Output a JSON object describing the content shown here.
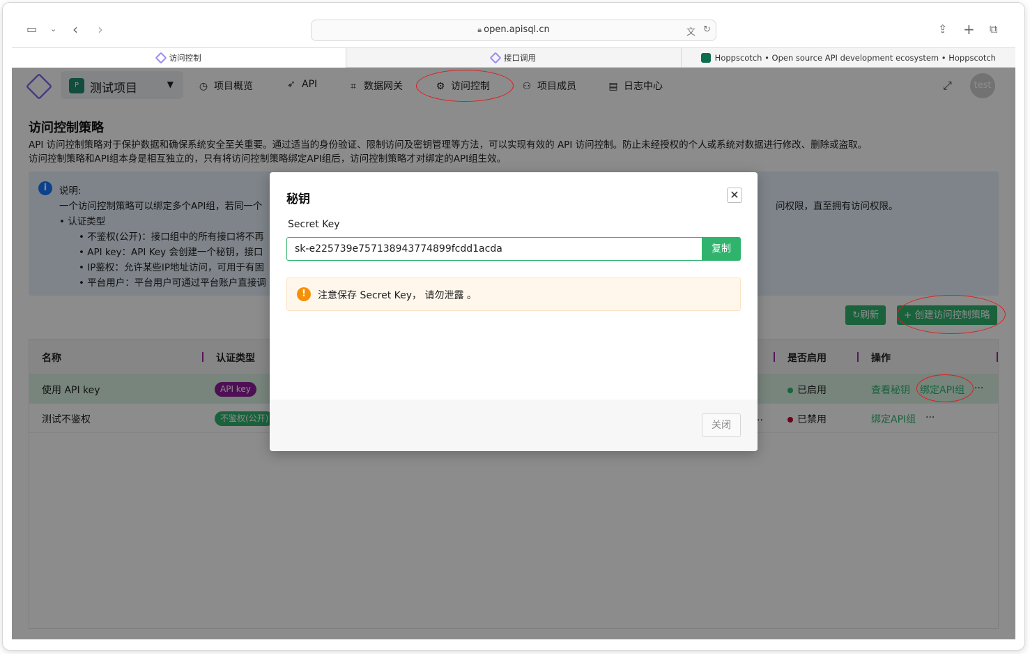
{
  "browser": {
    "url": "open.apisql.cn",
    "tabs": [
      {
        "label": "访问控制",
        "active": true
      },
      {
        "label": "接口调用",
        "active": false
      },
      {
        "label": "Hoppscotch • Open source API development ecosystem • Hoppscotch",
        "active": false
      }
    ]
  },
  "nav": {
    "project": "测试项目",
    "project_icon_letter": "P",
    "items": [
      {
        "label": "项目概览",
        "icon": "dashboard-icon"
      },
      {
        "label": "API",
        "icon": "rocket-icon"
      },
      {
        "label": "数据网关",
        "icon": "gateway-icon"
      },
      {
        "label": "访问控制",
        "icon": "gear-icon"
      },
      {
        "label": "项目成员",
        "icon": "members-icon"
      },
      {
        "label": "日志中心",
        "icon": "log-icon"
      }
    ],
    "avatar": "test"
  },
  "page": {
    "title": "访问控制策略",
    "desc1": "API 访问控制策略对于保护数据和确保系统安全至关重要。通过适当的身份验证、限制访问及密钥管理等方法，可以实现有效的 API 访问控制。防止未经授权的个人或系统对数据进行修改、删除或盗取。",
    "desc2": "访问控制策略和API组本身是相互独立的，只有将访问控制策略绑定API组后，访问控制策略才对绑定的API组生效。"
  },
  "info": {
    "heading": "说明:",
    "line1_left": "一个访问控制策略可以绑定多个API组，若同一个",
    "line1_right": "问权限，直至拥有访问权限。",
    "bullet_auth": "认证类型",
    "sub1": "不鉴权(公开)：接口组中的所有接口将不再",
    "sub2": "API key：API Key 会创建一个秘钥，接口",
    "sub3": "IP鉴权：允许某些IP地址访问，可用于有固",
    "sub4": "平台用户：平台用户可通过平台账户直接调"
  },
  "actions": {
    "refresh": "刷新",
    "create": "创建访问控制策略"
  },
  "table": {
    "headers": {
      "name": "名称",
      "auth": "认证类型",
      "enabled": "是否启用",
      "ops": "操作"
    },
    "rows": [
      {
        "name": "使用 API key",
        "auth": "API key",
        "auth_color": "#8e1d9a",
        "status": "已启用",
        "status_color": "#2fb36d",
        "op1": "查看秘钥",
        "op2": "绑定API组",
        "more": "···",
        "trunc": ""
      },
      {
        "name": "测试不鉴权",
        "auth": "不鉴权(公开)",
        "auth_color": "#2fb36d",
        "status": "已禁用",
        "status_color": "#c4002b",
        "op1": "绑定API组",
        "more": "···",
        "trunc": ".."
      }
    ]
  },
  "modal": {
    "title": "秘钥",
    "field_label": "Secret Key",
    "secret_key": "sk-e225739e757138943774899fcdd1acda",
    "copy": "复制",
    "warning": "注意保存 Secret Key， 请勿泄露 。",
    "close": "关闭"
  },
  "colors": {
    "accent": "#2fb36d",
    "highlight_ring": "#e01c1c"
  }
}
